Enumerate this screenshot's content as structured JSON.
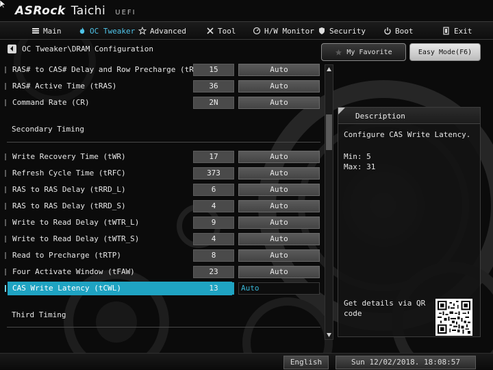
{
  "brand": {
    "logo": "ASRock",
    "series": "Taichi",
    "edition": "UEFI"
  },
  "nav": {
    "items": [
      {
        "label": "Main",
        "icon": "list-icon"
      },
      {
        "label": "OC Tweaker",
        "icon": "flame-icon"
      },
      {
        "label": "Advanced",
        "icon": "star-icon"
      },
      {
        "label": "Tool",
        "icon": "tools-icon"
      },
      {
        "label": "H/W Monitor",
        "icon": "monitor-icon"
      },
      {
        "label": "Security",
        "icon": "shield-icon"
      },
      {
        "label": "Boot",
        "icon": "power-icon"
      },
      {
        "label": "Exit",
        "icon": "exit-door-icon"
      }
    ],
    "active": "OC Tweaker"
  },
  "breadcrumb": {
    "path": "OC Tweaker\\DRAM Configuration"
  },
  "buttons": {
    "favorite": "My Favorite",
    "easy_mode": "Easy Mode(F6)"
  },
  "primary_rows": [
    {
      "label": "RAS# to CAS# Delay and Row Precharge (tRCDtRP)",
      "value": "15",
      "setting": "Auto"
    },
    {
      "label": "RAS# Active Time (tRAS)",
      "value": "36",
      "setting": "Auto"
    },
    {
      "label": "Command Rate (CR)",
      "value": "2N",
      "setting": "Auto"
    }
  ],
  "secondary": {
    "title": "Secondary Timing",
    "rows": [
      {
        "label": "Write Recovery Time (tWR)",
        "value": "17",
        "setting": "Auto"
      },
      {
        "label": "Refresh Cycle Time (tRFC)",
        "value": "373",
        "setting": "Auto"
      },
      {
        "label": "RAS to RAS Delay (tRRD_L)",
        "value": "6",
        "setting": "Auto"
      },
      {
        "label": "RAS to RAS Delay (tRRD_S)",
        "value": "4",
        "setting": "Auto"
      },
      {
        "label": "Write to Read Delay (tWTR_L)",
        "value": "9",
        "setting": "Auto"
      },
      {
        "label": "Write to Read Delay (tWTR_S)",
        "value": "4",
        "setting": "Auto"
      },
      {
        "label": "Read to Precharge (tRTP)",
        "value": "8",
        "setting": "Auto"
      },
      {
        "label": "Four Activate Window (tFAW)",
        "value": "23",
        "setting": "Auto"
      },
      {
        "label": "CAS Write Latency (tCWL)",
        "value": "13",
        "setting": "Auto"
      }
    ],
    "selected_label": "CAS Write Latency (tCWL)"
  },
  "third": {
    "title": "Third Timing"
  },
  "description": {
    "title": "Description",
    "text": "Configure CAS Write Latency.",
    "min": "Min: 5",
    "max": "Max: 31",
    "qr_text": "Get details via QR code"
  },
  "footer": {
    "language": "English",
    "datetime": "Sun 12/02/2018. 18:08:57"
  },
  "colors": {
    "accent": "#1fa3c2",
    "nav_active": "#4fc3e8"
  }
}
